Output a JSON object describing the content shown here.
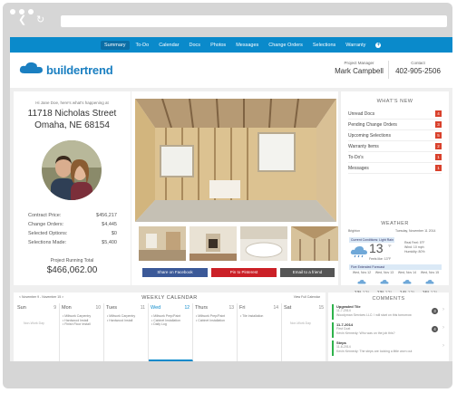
{
  "nav": {
    "items": [
      "Summary",
      "To-Do",
      "Calendar",
      "Docs",
      "Photos",
      "Messages",
      "Change Orders",
      "Selections",
      "Warranty"
    ],
    "active": "Summary"
  },
  "header": {
    "logo_text": "buildertrend",
    "pm_label": "Project Manager",
    "pm_name": "Mark Campbell",
    "contact_label": "Contact",
    "contact_phone": "402-905-2506"
  },
  "project": {
    "greeting": "Hi Jane Doe, here's what's happening at",
    "address_line1": "11718 Nicholas Street",
    "address_line2": "Omaha, NE 68154",
    "stats": [
      {
        "label": "Contract Price:",
        "value": "$456,217"
      },
      {
        "label": "Change Orders:",
        "value": "$4,445"
      },
      {
        "label": "Selected Options:",
        "value": "$0"
      },
      {
        "label": "Selections Made:",
        "value": "$5,400"
      }
    ],
    "running_label": "Project Running Total",
    "running_value": "$466,062.00"
  },
  "share": {
    "facebook": "Share on Facebook",
    "pinterest": "Pin to Pinterest",
    "email": "Email to a friend"
  },
  "whats_new": {
    "title": "WHAT'S NEW",
    "items": [
      {
        "label": "Unread Docs",
        "count": "4"
      },
      {
        "label": "Pending Change Orders",
        "count": "3"
      },
      {
        "label": "Upcoming Selections",
        "count": "5"
      },
      {
        "label": "Warranty Items",
        "count": "2"
      },
      {
        "label": "To-Do's",
        "count": "1"
      },
      {
        "label": "Messages",
        "count": "1"
      }
    ]
  },
  "weather": {
    "title": "WEATHER",
    "city": "Brighton",
    "date": "Tuesday, November 11 2014",
    "current_label": "Current Conditions: Light Rain",
    "temp": "13",
    "temp_unit": "°F",
    "feels_like": "Feels like: 13°F",
    "details": [
      "Real Feel: 5°F",
      "Wind: 10 mph",
      "Humidity: 80%"
    ],
    "extended_label": "Five Extended Forecast",
    "forecast": [
      {
        "day": "Wed, Nov 12",
        "temps": [
          "13°",
          "12°"
        ]
      },
      {
        "day": "Wed, Nov 13",
        "temps": [
          "13°",
          "12°"
        ]
      },
      {
        "day": "Wed, Nov 14",
        "temps": [
          "14°",
          "12°"
        ]
      },
      {
        "day": "Wed, Nov 15",
        "temps": [
          "15°",
          "12°"
        ]
      }
    ],
    "forecast_row2": [
      {
        "temps": [
          "13°",
          "13°"
        ]
      },
      {
        "temps": [
          "13°",
          "12°"
        ]
      },
      {
        "temps": [
          "14°",
          "12°"
        ]
      },
      {
        "temps": [
          "14°",
          "12°"
        ]
      }
    ]
  },
  "calendar": {
    "title": "WEEKLY CALENDAR",
    "range": "< November 9 - November 15 >",
    "link": "View Full Calendar",
    "days": [
      {
        "name": "Sun",
        "num": "9",
        "items": [
          "Non-Work Day"
        ]
      },
      {
        "name": "Mon",
        "num": "10",
        "items": [
          "• Millwork Carpentry",
          "• Hardwood Install",
          "• Finish Floor Install"
        ]
      },
      {
        "name": "Tues",
        "num": "11",
        "items": [
          "• Millwork Carpentry",
          "• Hardwood Install"
        ]
      },
      {
        "name": "Wed",
        "num": "12",
        "items": [
          "• Millwork Prep/Paint",
          "• Cabinet Installation",
          "• Daily Log"
        ]
      },
      {
        "name": "Thurs",
        "num": "13",
        "items": [
          "• Millwork Prep/Paint",
          "• Cabinet Installation"
        ]
      },
      {
        "name": "Fri",
        "num": "14",
        "items": [
          "• Tile Installation"
        ]
      },
      {
        "name": "Sat",
        "num": "15",
        "items": [
          "Non-Work Day"
        ]
      }
    ]
  },
  "comments": {
    "title": "COMMENTS",
    "items": [
      {
        "title": "Upgraded Tile",
        "sub1": "11-7-2014",
        "sub2": "Woodyman Services LLC: I will start on this tomorrow",
        "count": "3"
      },
      {
        "title": "11-7-2014",
        "sub1": "First Coat",
        "sub2": "Kevin Kennedy: Who was on the job this?",
        "count": "4"
      },
      {
        "title": "Steps",
        "sub1": "11-6-2014",
        "sub2": "Kevin Kennedy: The steps are looking a little worn out",
        "count": ""
      }
    ]
  },
  "colors": {
    "brand_blue": "#0a8acb",
    "badge_red": "#d9412c",
    "facebook": "#3b5998",
    "pinterest": "#cb2027",
    "email": "#555555",
    "comment_green": "#2eb24b"
  }
}
